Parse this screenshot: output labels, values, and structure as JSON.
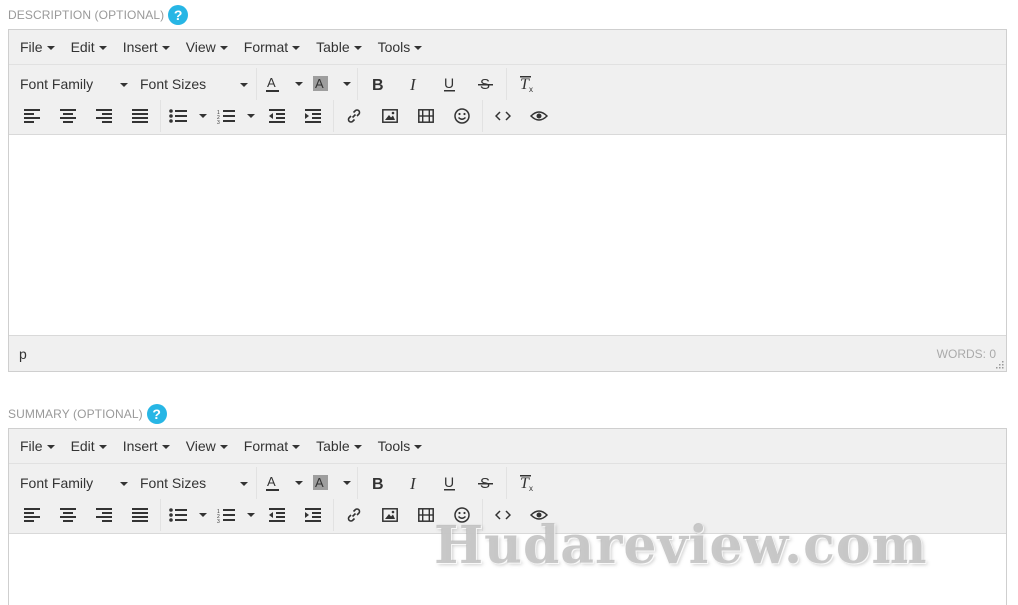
{
  "colors": {
    "help_icon": "#27b6e5",
    "toolbar_bg": "#f0f0f0",
    "label_text": "#999999",
    "highlight_bg": "#9e9e9e"
  },
  "description": {
    "label": "DESCRIPTION (OPTIONAL)",
    "help": "?",
    "menu": [
      "File",
      "Edit",
      "Insert",
      "View",
      "Format",
      "Table",
      "Tools"
    ],
    "font_family": "Font Family",
    "font_sizes": "Font Sizes",
    "status_path": "p",
    "word_count": "WORDS: 0"
  },
  "summary": {
    "label": "SUMMARY (OPTIONAL)",
    "help": "?",
    "menu": [
      "File",
      "Edit",
      "Insert",
      "View",
      "Format",
      "Table",
      "Tools"
    ],
    "font_family": "Font Family",
    "font_sizes": "Font Sizes"
  },
  "watermark": "Hudareview.com"
}
